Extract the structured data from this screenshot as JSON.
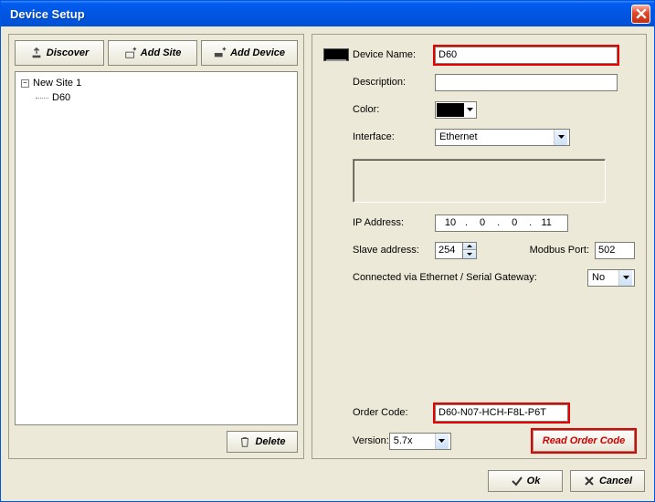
{
  "window": {
    "title": "Device Setup"
  },
  "toolbar": {
    "discover": "Discover",
    "addSite": "Add Site",
    "addDevice": "Add Device",
    "delete": "Delete"
  },
  "tree": {
    "site": "New Site 1",
    "device": "D60"
  },
  "form": {
    "labels": {
      "deviceName": "Device Name:",
      "description": "Description:",
      "color": "Color:",
      "interface": "Interface:",
      "ipAddress": "IP Address:",
      "slaveAddress": "Slave address:",
      "modbusPort": "Modbus Port:",
      "connectedVia": "Connected via  Ethernet / Serial Gateway:",
      "orderCode": "Order Code:",
      "version": "Version:"
    },
    "values": {
      "deviceName": "D60",
      "description": "",
      "color": "#000000",
      "interface": "Ethernet",
      "ip": [
        "10",
        "0",
        "0",
        "11"
      ],
      "slaveAddress": "254",
      "modbusPort": "502",
      "gateway": "No",
      "orderCode": "D60-N07-HCH-F8L-P6T",
      "version": "5.7x"
    },
    "buttons": {
      "readOrderCode": "Read Order Code"
    }
  },
  "footer": {
    "ok": "Ok",
    "cancel": "Cancel"
  }
}
